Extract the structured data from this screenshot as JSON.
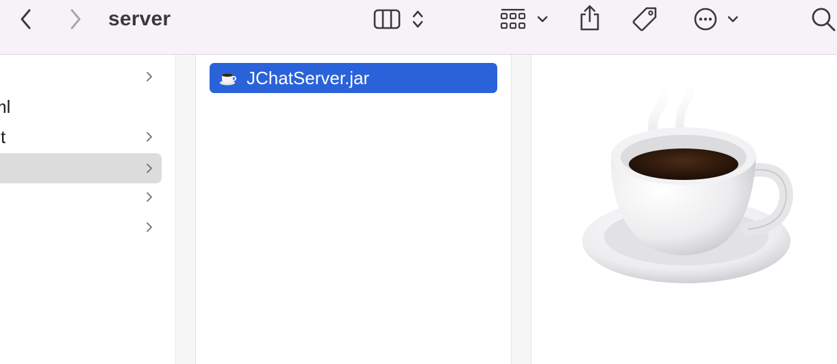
{
  "window": {
    "title": "server"
  },
  "toolbar": {
    "back_icon": "chevron-left-icon",
    "forward_icon": "chevron-right-icon",
    "view_icon": "column-view-icon",
    "view_toggle_icon": "chevron-up-down-icon",
    "group_icon": "grid-group-icon",
    "group_menu_icon": "chevron-down-icon",
    "share_icon": "share-icon",
    "tag_icon": "tag-icon",
    "more_icon": "ellipsis-circle-icon",
    "more_menu_icon": "chevron-down-icon",
    "search_icon": "search-icon"
  },
  "columns": {
    "parent": {
      "items": [
        {
          "label": "",
          "has_children": true,
          "selected": false
        },
        {
          "label": "ml",
          "has_children": false,
          "selected": false
        },
        {
          "label": "st",
          "has_children": true,
          "selected": false
        },
        {
          "label": "",
          "has_children": true,
          "selected": true
        },
        {
          "label": "",
          "has_children": true,
          "selected": false
        },
        {
          "label": "",
          "has_children": true,
          "selected": false
        }
      ]
    },
    "current": {
      "items": [
        {
          "name": "JChatServer.jar",
          "icon": "java-coffee-cup-icon",
          "selected": true
        }
      ]
    },
    "preview": {
      "icon": "java-coffee-cup-icon"
    }
  },
  "colors": {
    "toolbar_bg": "#f7f2f8",
    "selection_blue": "#2a62d9",
    "selection_gray": "#dcdcdc"
  }
}
